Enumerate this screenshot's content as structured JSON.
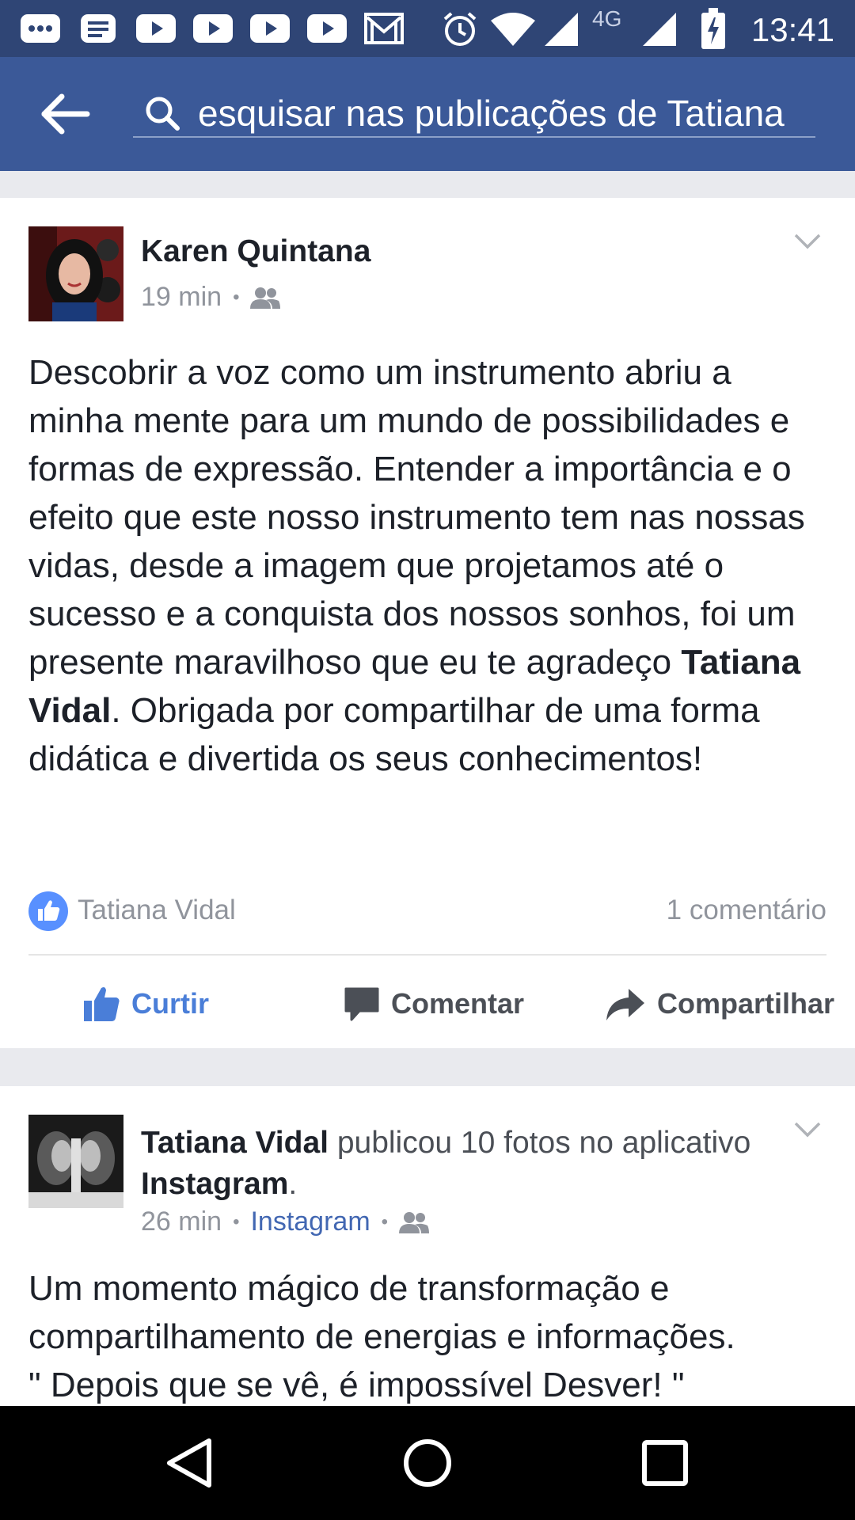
{
  "status_bar": {
    "network": "4G",
    "time": "13:41"
  },
  "search": {
    "value": "esquisar nas publicações de Tatiana"
  },
  "post1": {
    "author": "Karen Quintana",
    "time": "19 min",
    "separator": "•",
    "body_part1": "Descobrir a voz como um instrumento abriu a minha mente para um mundo de possibilidades e formas de expressão. Entender a importância e o efeito que este nosso instrumento tem nas nossas vidas, desde a imagem que projetamos até o sucesso e a conquista dos nossos sonhos, foi um presente maravilhoso que eu te agradeço ",
    "body_mention": "Tatiana Vidal",
    "body_part2": ". Obrigada por compartilhar de uma forma didática e divertida os seus conhecimentos!",
    "reactors": "Tatiana Vidal",
    "comment_count": "1 comentário",
    "actions": {
      "like": "Curtir",
      "comment": "Comentar",
      "share": "Compartilhar"
    }
  },
  "post2": {
    "author": "Tatiana Vidal",
    "action_text": " publicou 10 fotos no aplicativo ",
    "app": "Instagram",
    "period": ".",
    "time": "26 min",
    "separator": "•",
    "source": "Instagram",
    "body_line1": "Um momento mágico de transformação e compartilhamento de energias e informações.",
    "body_line2": "\"  Depois que se vê, é impossível Desver! \""
  },
  "colors": {
    "status_bar": "#2f4575",
    "header": "#3b5998",
    "like_blue": "#4a7ed8",
    "badge_blue": "#5890ff",
    "link_blue": "#4267b2"
  }
}
